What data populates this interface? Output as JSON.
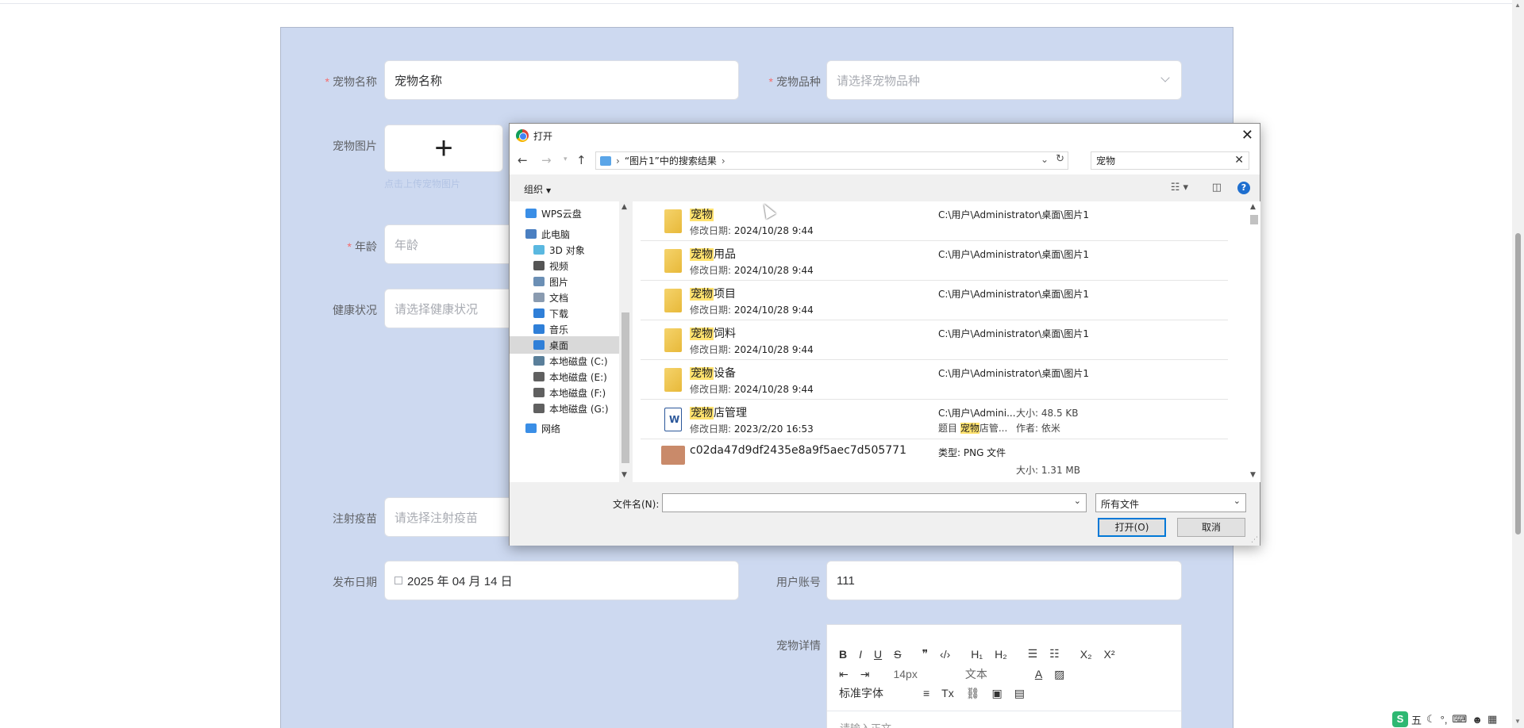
{
  "form": {
    "pet_name": {
      "label": "宠物名称",
      "value": "宠物名称"
    },
    "pet_breed": {
      "label": "宠物品种",
      "placeholder": "请选择宠物品种"
    },
    "pet_image": {
      "label": "宠物图片",
      "tip": "点击上传宠物图片"
    },
    "age": {
      "label": "年龄",
      "placeholder": "年龄"
    },
    "health": {
      "label": "健康状况",
      "placeholder": "请选择健康状况"
    },
    "vaccine": {
      "label": "注射疫苗",
      "placeholder": "请选择注射疫苗"
    },
    "publish_date": {
      "label": "发布日期",
      "value": "2025 年 04 月 14 日"
    },
    "user_account": {
      "label": "用户账号",
      "value": "111"
    },
    "pet_detail": {
      "label": "宠物详情"
    }
  },
  "editor": {
    "font_size": "14px",
    "text_type": "文本",
    "font_family": "标准字体",
    "placeholder": "请输入正文"
  },
  "dialog": {
    "title": "打开",
    "breadcrumb": "“图片1”中的搜索结果",
    "search_value": "宠物",
    "organize": "组织",
    "tree": [
      {
        "label": "WPS云盘",
        "color": "#3a8ee6"
      },
      {
        "label": "此电脑",
        "color": "#4a7fc1"
      },
      {
        "label": "3D 对象",
        "color": "#5ab8e0"
      },
      {
        "label": "视频",
        "color": "#555555"
      },
      {
        "label": "图片",
        "color": "#6b8fb5"
      },
      {
        "label": "文档",
        "color": "#8a9bb0"
      },
      {
        "label": "下载",
        "color": "#2f7fd8"
      },
      {
        "label": "音乐",
        "color": "#2f7fd8"
      },
      {
        "label": "桌面",
        "color": "#2f7fd8"
      },
      {
        "label": "本地磁盘 (C:)",
        "color": "#5a7f9a"
      },
      {
        "label": "本地磁盘 (E:)",
        "color": "#606060"
      },
      {
        "label": "本地磁盘 (F:)",
        "color": "#606060"
      },
      {
        "label": "本地磁盘 (G:)",
        "color": "#606060"
      },
      {
        "label": "网络",
        "color": "#3a8ee6"
      }
    ],
    "files": [
      {
        "hl": "宠物",
        "rest": "",
        "date_label": "修改日期:",
        "date": "2024/10/28 9:44",
        "path": "C:\\用户\\Administrator\\桌面\\图片1"
      },
      {
        "hl": "宠物",
        "rest": "用品",
        "date_label": "修改日期:",
        "date": "2024/10/28 9:44",
        "path": "C:\\用户\\Administrator\\桌面\\图片1"
      },
      {
        "hl": "宠物",
        "rest": "项目",
        "date_label": "修改日期:",
        "date": "2024/10/28 9:44",
        "path": "C:\\用户\\Administrator\\桌面\\图片1"
      },
      {
        "hl": "宠物",
        "rest": "饲料",
        "date_label": "修改日期:",
        "date": "2024/10/28 9:44",
        "path": "C:\\用户\\Administrator\\桌面\\图片1"
      },
      {
        "hl": "宠物",
        "rest": "设备",
        "date_label": "修改日期:",
        "date": "2024/10/28 9:44",
        "path": "C:\\用户\\Administrator\\桌面\\图片1"
      }
    ],
    "doc_file": {
      "hl": "宠物",
      "rest": "店管理",
      "date_label": "修改日期:",
      "date": "2023/2/20 16:53",
      "path": "C:\\用户\\Admini...",
      "meta_pre": "题目",
      "meta_hl": "宠物",
      "meta_post": "店管...",
      "size": "大小: 48.5 KB",
      "author": "作者: 依米"
    },
    "png_file": {
      "name": "c02da47d9df2435e8a9f5aec7d505771",
      "type": "类型: PNG 文件",
      "size": "大小: 1.31 MB"
    },
    "filename_label": "文件名(N):",
    "filetype": "所有文件",
    "open_button": "打开(O)",
    "cancel_button": "取消"
  },
  "ime": {
    "mode": "五"
  }
}
